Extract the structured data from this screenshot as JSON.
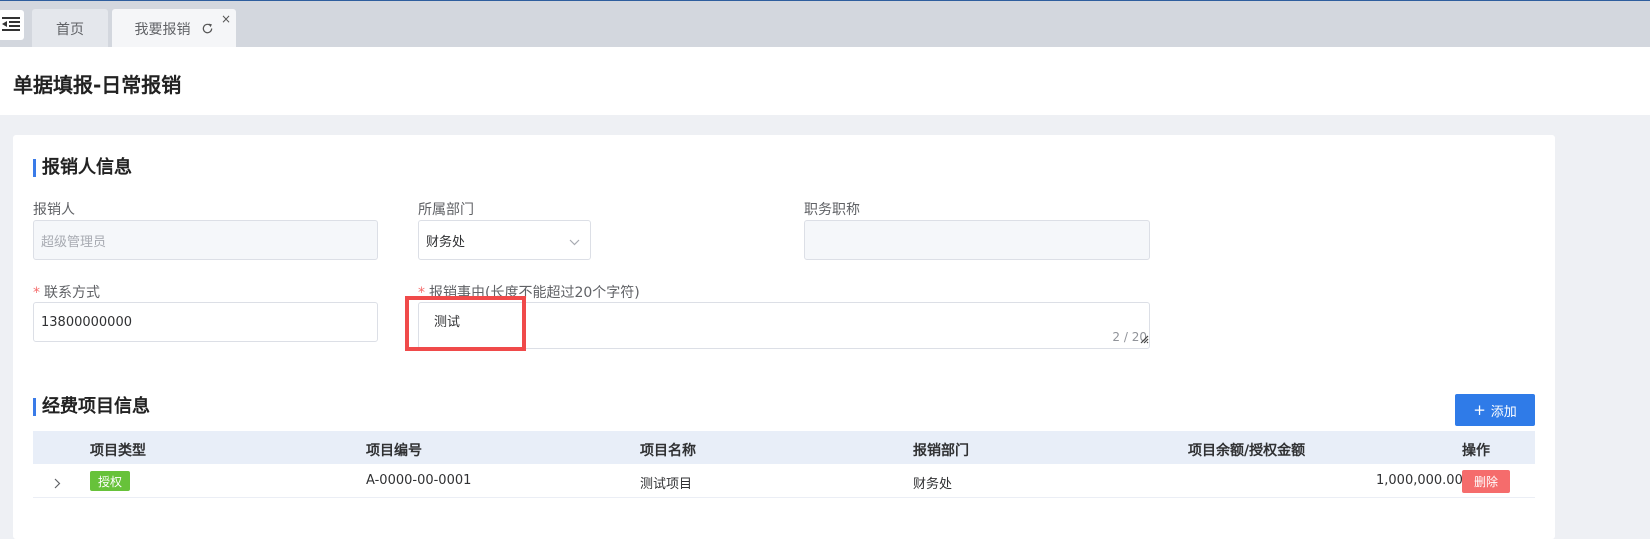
{
  "tabs": [
    {
      "label": "首页",
      "active": false
    },
    {
      "label": "我要报销",
      "active": true
    }
  ],
  "tab_close": "×",
  "page_title": "单据填报-日常报销",
  "applicant_section": {
    "title": "报销人信息",
    "applicant": {
      "label": "报销人",
      "value": "超级管理员"
    },
    "department": {
      "label": "所属部门",
      "value": "财务处"
    },
    "position": {
      "label": "职务职称",
      "value": ""
    },
    "contact": {
      "required_mark": "*",
      "label": "联系方式",
      "value": "13800000000"
    },
    "reason": {
      "required_mark": "*",
      "label": "报销事由(长度不能超过20个字符)",
      "value": "测试",
      "counter": "2 / 20"
    }
  },
  "expense_section": {
    "title": "经费项目信息",
    "add_button": {
      "icon": "+",
      "label": "添加"
    },
    "columns": [
      "项目类型",
      "项目编号",
      "项目名称",
      "报销部门",
      "项目余额/授权金额",
      "操作"
    ],
    "rows": [
      {
        "type_tag": "授权",
        "code": "A-0000-00-0001",
        "name": "测试项目",
        "department": "财务处",
        "amount": "1,000,000.00",
        "delete_label": "删除"
      }
    ]
  },
  "colors": {
    "primary": "#2f7be8",
    "tag_green": "#67c23a",
    "danger": "#f56c6c",
    "highlight": "#f04a4a"
  }
}
